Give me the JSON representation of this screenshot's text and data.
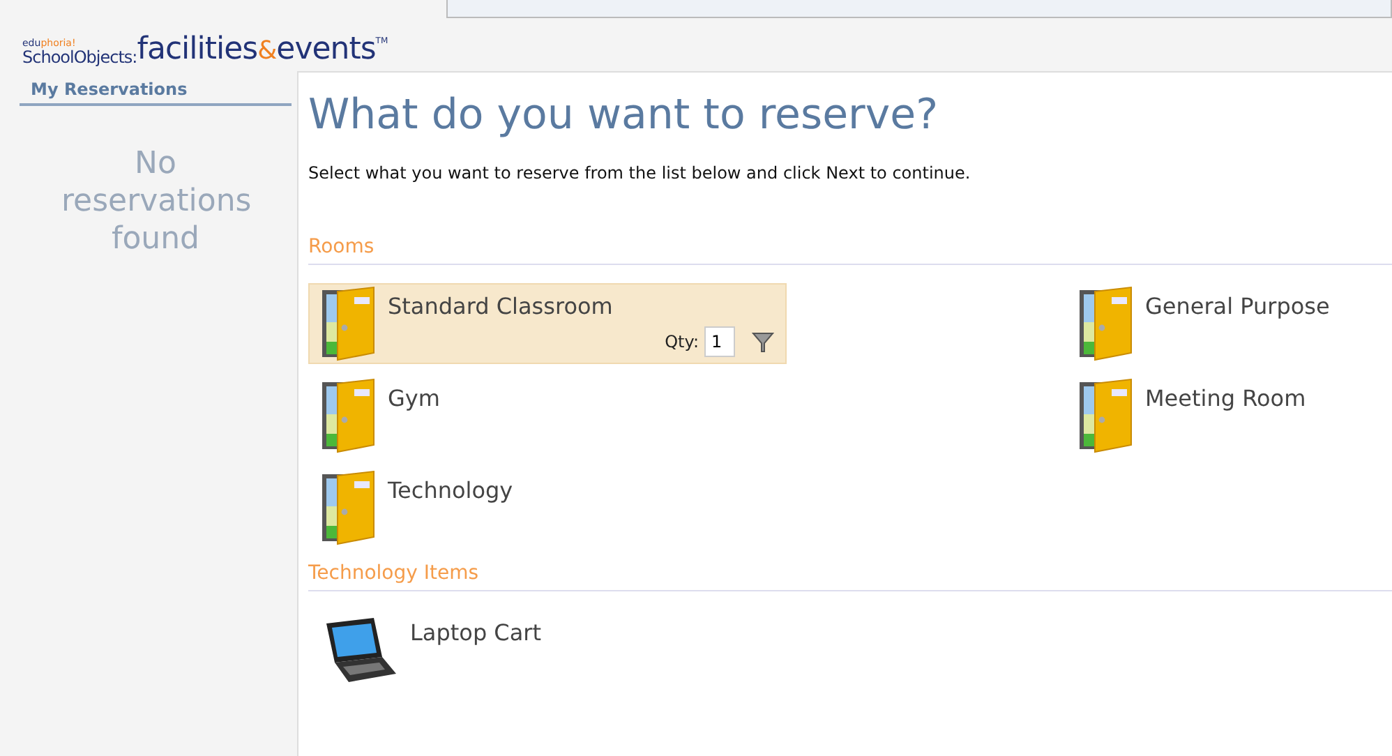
{
  "logo": {
    "edu": "edu",
    "phoria": "phoria!",
    "school_objects": "SchoolObjects:",
    "facilities": "facilities",
    "amp": "&",
    "events": "events",
    "tm": "TM"
  },
  "sidebar": {
    "title": "My Reservations",
    "empty_text": "No reservations found"
  },
  "main": {
    "heading": "What do you want to reserve?",
    "instructions": "Select what you want to reserve from the list below and click Next to continue.",
    "sections": [
      {
        "title": "Rooms",
        "items": [
          {
            "kind": "room",
            "label": "Standard Classroom",
            "selected": true,
            "qty_label": "Qty:",
            "qty_value": "1"
          },
          {
            "kind": "room",
            "label": "General Purpose",
            "selected": false
          },
          {
            "kind": "room",
            "label": "Gym",
            "selected": false
          },
          {
            "kind": "room",
            "label": "Meeting Room",
            "selected": false
          },
          {
            "kind": "room",
            "label": "Technology",
            "selected": false
          }
        ]
      },
      {
        "title": "Technology Items",
        "items": [
          {
            "kind": "laptop",
            "label": "Laptop Cart",
            "selected": false
          }
        ]
      }
    ]
  }
}
